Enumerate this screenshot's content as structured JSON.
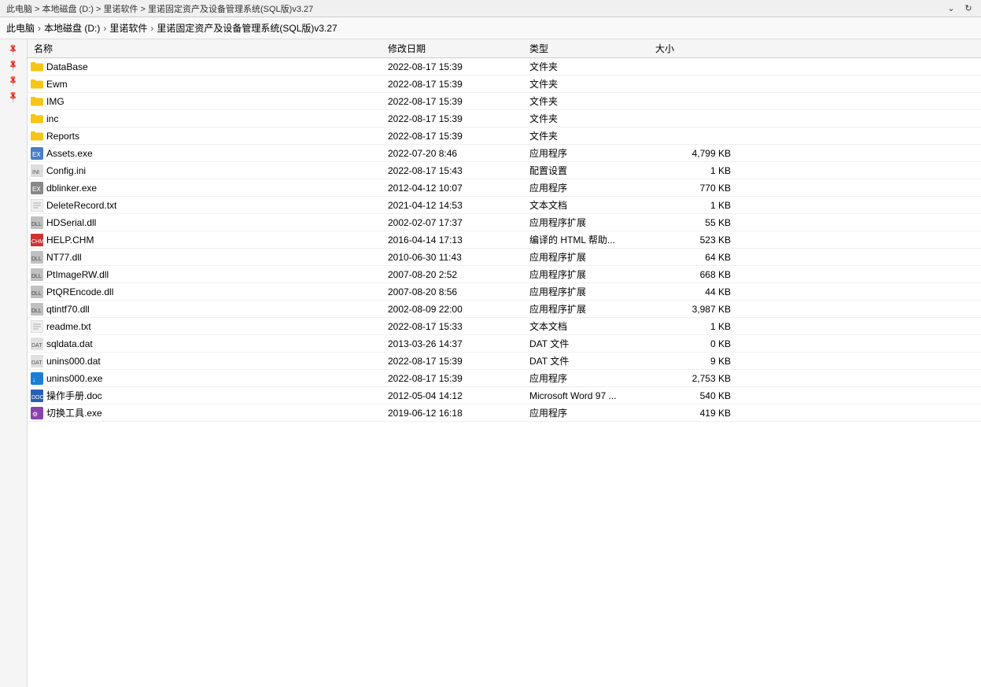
{
  "window": {
    "title": "此电脑 > 本地磁盘 (D:) > 里诺软件 > 里诺固定资产及设备管理系统(SQL版)v3.27"
  },
  "breadcrumb": {
    "parts": [
      "此电脑",
      "本地磁盘 (D:)",
      "里诺软件",
      "里诺固定资产及设备管理系统(SQL版)v3.27"
    ]
  },
  "columns": {
    "name": "名称",
    "modified": "修改日期",
    "type": "类型",
    "size": "大小"
  },
  "files": [
    {
      "name": "DataBase",
      "modified": "2022-08-17 15:39",
      "type": "文件夹",
      "size": "",
      "icon": "folder"
    },
    {
      "name": "Ewm",
      "modified": "2022-08-17 15:39",
      "type": "文件夹",
      "size": "",
      "icon": "folder"
    },
    {
      "name": "IMG",
      "modified": "2022-08-17 15:39",
      "type": "文件夹",
      "size": "",
      "icon": "folder"
    },
    {
      "name": "inc",
      "modified": "2022-08-17 15:39",
      "type": "文件夹",
      "size": "",
      "icon": "folder"
    },
    {
      "name": "Reports",
      "modified": "2022-08-17 15:39",
      "type": "文件夹",
      "size": "",
      "icon": "folder"
    },
    {
      "name": "Assets.exe",
      "modified": "2022-07-20 8:46",
      "type": "应用程序",
      "size": "4,799 KB",
      "icon": "exe"
    },
    {
      "name": "Config.ini",
      "modified": "2022-08-17 15:43",
      "type": "配置设置",
      "size": "1 KB",
      "icon": "ini"
    },
    {
      "name": "dblinker.exe",
      "modified": "2012-04-12 10:07",
      "type": "应用程序",
      "size": "770 KB",
      "icon": "exe2"
    },
    {
      "name": "DeleteRecord.txt",
      "modified": "2021-04-12 14:53",
      "type": "文本文档",
      "size": "1 KB",
      "icon": "txt"
    },
    {
      "name": "HDSerial.dll",
      "modified": "2002-02-07 17:37",
      "type": "应用程序扩展",
      "size": "55 KB",
      "icon": "dll"
    },
    {
      "name": "HELP.CHM",
      "modified": "2016-04-14 17:13",
      "type": "编译的 HTML 帮助...",
      "size": "523 KB",
      "icon": "chm"
    },
    {
      "name": "NT77.dll",
      "modified": "2010-06-30 11:43",
      "type": "应用程序扩展",
      "size": "64 KB",
      "icon": "dll"
    },
    {
      "name": "PtImageRW.dll",
      "modified": "2007-08-20 2:52",
      "type": "应用程序扩展",
      "size": "668 KB",
      "icon": "dll"
    },
    {
      "name": "PtQREncode.dll",
      "modified": "2007-08-20 8:56",
      "type": "应用程序扩展",
      "size": "44 KB",
      "icon": "dll"
    },
    {
      "name": "qtintf70.dll",
      "modified": "2002-08-09 22:00",
      "type": "应用程序扩展",
      "size": "3,987 KB",
      "icon": "dll"
    },
    {
      "name": "readme.txt",
      "modified": "2022-08-17 15:33",
      "type": "文本文档",
      "size": "1 KB",
      "icon": "txt"
    },
    {
      "name": "sqldata.dat",
      "modified": "2013-03-26 14:37",
      "type": "DAT 文件",
      "size": "0 KB",
      "icon": "dat"
    },
    {
      "name": "unins000.dat",
      "modified": "2022-08-17 15:39",
      "type": "DAT 文件",
      "size": "9 KB",
      "icon": "dat"
    },
    {
      "name": "unins000.exe",
      "modified": "2022-08-17 15:39",
      "type": "应用程序",
      "size": "2,753 KB",
      "icon": "down"
    },
    {
      "name": "操作手册.doc",
      "modified": "2012-05-04 14:12",
      "type": "Microsoft Word 97 ...",
      "size": "540 KB",
      "icon": "doc"
    },
    {
      "name": "切换工具.exe",
      "modified": "2019-06-12 16:18",
      "type": "应用程序",
      "size": "419 KB",
      "icon": "tool"
    }
  ],
  "left_panel": {
    "pins": [
      "📌",
      "📌",
      "📌",
      "📌"
    ]
  }
}
